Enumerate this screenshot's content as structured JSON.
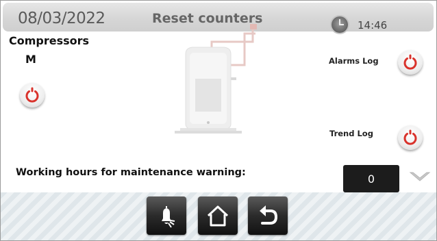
{
  "header": {
    "date": "08/03/2022",
    "title": "Reset counters",
    "time": "14:46"
  },
  "section": {
    "title": "Compressors",
    "subtitle": "M"
  },
  "logs": {
    "alarms_label": "Alarms Log",
    "trend_label": "Trend Log"
  },
  "maintenance": {
    "label": "Working hours for maintenance warning:",
    "value": "0"
  },
  "icons": {
    "reset": "power-reset-icon",
    "clock": "clock-icon",
    "bell": "alarm-bell-icon",
    "home": "home-icon",
    "back": "back-icon",
    "dropdown": "chevron-down-icon"
  },
  "colors": {
    "reset_accent": "#d9322b",
    "header_bg": "#d8d8d8",
    "value_box_bg": "#1c1c1c"
  }
}
